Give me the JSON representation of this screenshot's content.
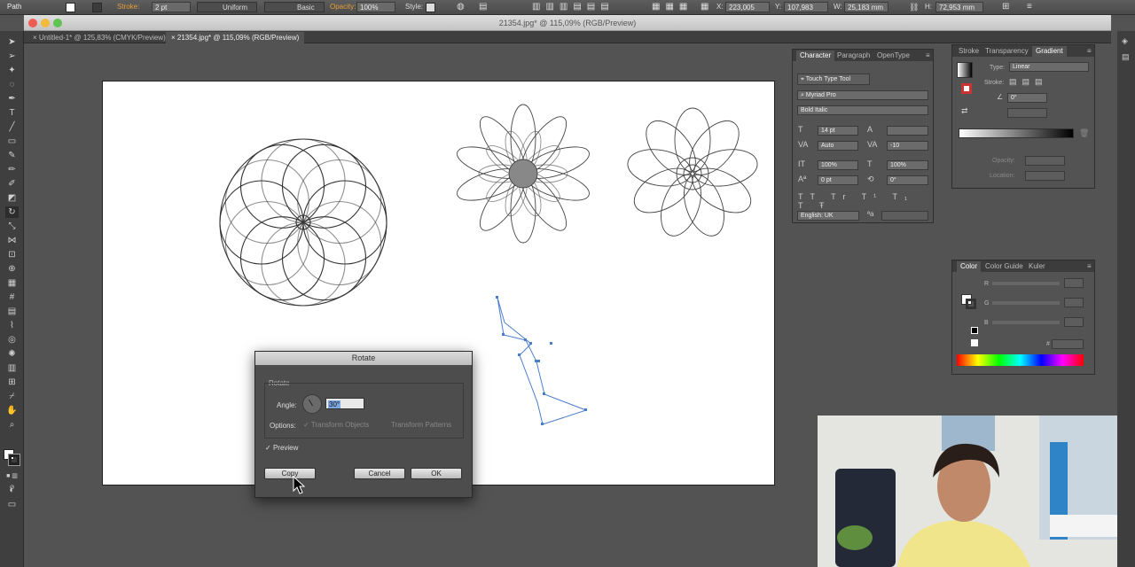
{
  "control_bar": {
    "selection_type": "Path",
    "stroke_label": "Stroke:",
    "stroke_weight": "2 pt",
    "profile": "Uniform",
    "brush": "Basic",
    "opacity_label": "Opacity:",
    "opacity_value": "100%",
    "style_label": "Style:",
    "x_label": "X:",
    "x_value": "223,005 mm",
    "y_label": "Y:",
    "y_value": "107,983 mm",
    "w_label": "W:",
    "w_value": "25,183 mm",
    "h_label": "H:",
    "h_value": "72,953 mm"
  },
  "window": {
    "title": "21354.jpg* @ 115,09% (RGB/Preview)"
  },
  "doc_tabs": [
    {
      "label": "Untitled-1* @ 125,83% (CMYK/Preview)",
      "active": false
    },
    {
      "label": "21354.jpg* @ 115,09% (RGB/Preview)",
      "active": true
    }
  ],
  "character_panel": {
    "tabs": [
      "Character",
      "Paragraph",
      "OpenType"
    ],
    "touch_type_tool": "Touch Type Tool",
    "font_family": "Myriad Pro",
    "font_style": "Bold Italic",
    "font_size": "14 pt",
    "leading": "",
    "kerning": "Auto",
    "tracking": "-10",
    "vertical_scale": "100%",
    "horizontal_scale": "100%",
    "baseline_shift": "0 pt",
    "rotation": "0°",
    "language": "English: UK"
  },
  "gradient_panel": {
    "tabs": [
      "Stroke",
      "Transparency",
      "Gradient"
    ],
    "type_label": "Type:",
    "type_value": "Linear",
    "stroke_label": "Stroke:",
    "angle_value": "0°",
    "opacity_label": "Opacity:",
    "location_label": "Location:"
  },
  "color_panel": {
    "tabs": [
      "Color",
      "Color Guide",
      "Kuler"
    ],
    "channels": [
      "R",
      "G",
      "B"
    ],
    "hex_label": "#"
  },
  "rotate_dialog": {
    "title": "Rotate",
    "group_label": "Rotate",
    "angle_label": "Angle:",
    "angle_value": "30°",
    "options_label": "Options:",
    "transform_objects": "Transform Objects",
    "transform_patterns": "Transform Patterns",
    "preview_label": "Preview",
    "preview_checked": true,
    "copy_button": "Copy",
    "cancel_button": "Cancel",
    "ok_button": "OK"
  },
  "colors": {
    "ui_dark": "#535353",
    "artboard": "#ffffff",
    "selection_blue": "#4a7dc9",
    "accent_orange": "#e8a03c"
  }
}
